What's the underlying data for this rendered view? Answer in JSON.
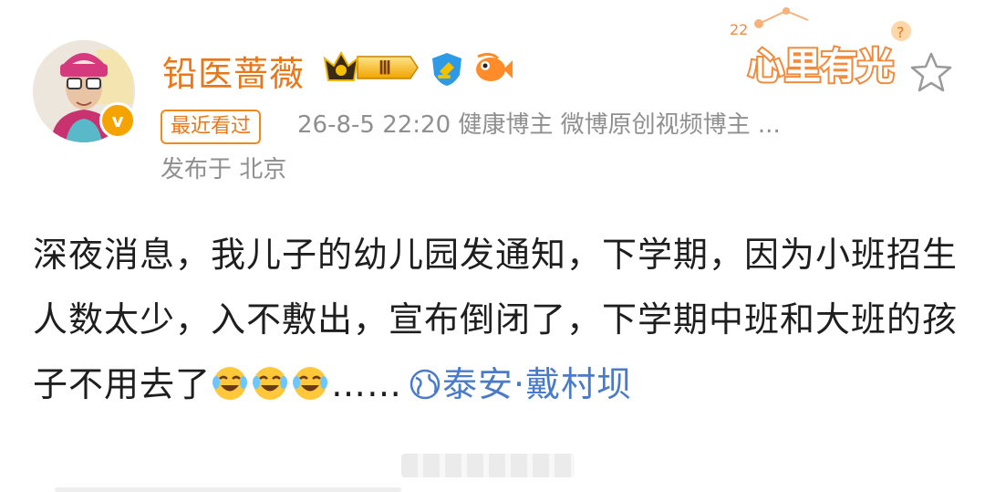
{
  "post": {
    "author": {
      "name": "铅医蔷薇",
      "level_badge": "Ⅲ",
      "verified_badge": "v",
      "avatar_icon": "avatar-person-icon"
    },
    "recent_tag": "最近看过",
    "time_and_source": "26-8-5 22:20  健康博主 微博原创视频博主 ...",
    "location_line": "发布于 北京",
    "sticker_text": "心里有光",
    "text_body": "深夜消息，我儿子的幼儿园发通知，下学期，因为小班招生人数太少，入不敷出，宣布倒闭了，下学期中班和大班的孩子不用去了",
    "ellipsis": "……",
    "location_link": "泰安·戴村坝",
    "emoji_names": [
      "laugh-cry-emoji",
      "laugh-cry-emoji",
      "laugh-cry-emoji"
    ]
  },
  "colors": {
    "username": "#e8771a",
    "meta_gray": "#8f8f8f",
    "link_blue": "#4a7bc9",
    "badge_gold": "#f5b400"
  }
}
